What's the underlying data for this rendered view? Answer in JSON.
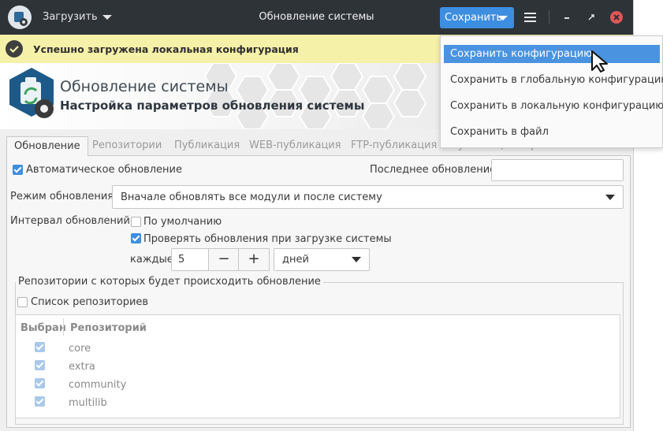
{
  "titlebar": {
    "load_label": "Загрузить",
    "title": "Обновление системы",
    "save_label": "Сохранить"
  },
  "infobar": {
    "message": "Успешно загружена локальная конфигурация"
  },
  "header": {
    "title": "Обновление системы",
    "subtitle": "Настройка параметров обновления системы"
  },
  "tabs": [
    {
      "label": "Обновление"
    },
    {
      "label": "Репозитории"
    },
    {
      "label": "Публикация"
    },
    {
      "label": "WEB-публикация"
    },
    {
      "label": "FTP-публикация"
    },
    {
      "label": "Публикация зеркала"
    }
  ],
  "update": {
    "auto_update_label": "Автоматическое обновление",
    "auto_update_checked": true,
    "last_update_label": "Последнее обновление:",
    "last_update_value": "",
    "mode_label": "Режим обновления:",
    "mode_value": "Вначале обновлять все модули и после систему",
    "interval_label": "Интервал обновлений:",
    "default_label": "По умолчанию",
    "default_checked": false,
    "check_on_boot_label": "Проверять обновления при загрузке системы",
    "check_on_boot_checked": true,
    "every_label": "каждые",
    "interval_value": "5",
    "minus": "−",
    "plus": "+",
    "unit_value": "дней"
  },
  "repos": {
    "group_title": "Репозитории с которых будет происходить обновление",
    "list_label": "Список репозиториев",
    "list_checked": false,
    "columns": [
      "Выбран",
      "Репозиторий"
    ],
    "rows": [
      {
        "name": "core",
        "selected": true
      },
      {
        "name": "extra",
        "selected": true
      },
      {
        "name": "community",
        "selected": true
      },
      {
        "name": "multilib",
        "selected": true
      }
    ]
  },
  "save_menu": {
    "items": [
      {
        "label": "Сохранить конфигурацию"
      },
      {
        "label": "Сохранить в глобальную конфигурацию"
      },
      {
        "label": "Сохранить в локальную конфигурацию"
      },
      {
        "label": "Сохранить в файл"
      }
    ]
  },
  "colors": {
    "accent": "#3d8ee0",
    "titlebar": "#2e3338",
    "infobar": "#f6f1a9",
    "close": "#e05757"
  }
}
